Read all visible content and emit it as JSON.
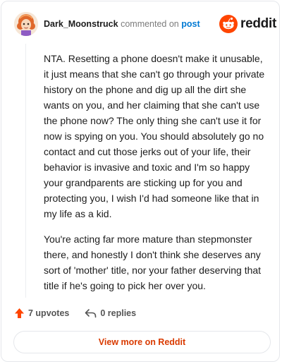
{
  "header": {
    "username": "Dark_Moonstruck",
    "commented_on": "commented on",
    "post_link": "post",
    "brand": "reddit"
  },
  "comment": {
    "paragraphs": [
      "NTA. Resetting a phone doesn't make it unusable, it just means that she can't go through your private history on the phone and dig up all the dirt she wants on you, and her claiming that she can't use the phone now? The only thing she can't use it for now is spying on you. You should absolutely go no contact and cut those jerks out of your life, their behavior is invasive and toxic and I'm so happy your grandparents are sticking up for you and protecting you, I wish I'd had someone like that in my life as a kid.",
      "You're acting far more mature than stepmonster there, and honestly I don't think she deserves any sort of 'mother' title, nor your father deserving that title if he's going to pick her over you."
    ]
  },
  "actions": {
    "upvotes": "7 upvotes",
    "replies": "0 replies"
  },
  "footer": {
    "view_more": "View more on Reddit"
  },
  "colors": {
    "accent": "#ff4500",
    "link": "#0079d3",
    "view_more": "#d93a00"
  },
  "icons": {
    "avatar": "avatar-image",
    "logo": "reddit-snoo-icon",
    "upvote": "upvote-arrow-icon",
    "reply": "reply-arrow-icon"
  }
}
